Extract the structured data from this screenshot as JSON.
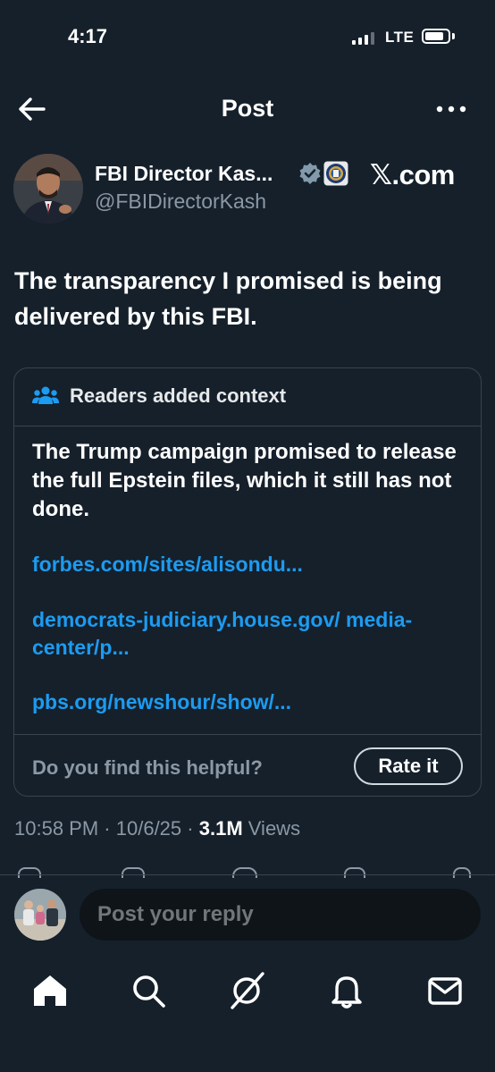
{
  "status_bar": {
    "time": "4:17",
    "network": "LTE"
  },
  "header": {
    "title": "Post",
    "back_icon": "arrow-left-icon",
    "more_icon": "more-horizontal-icon"
  },
  "author": {
    "name": "FBI Director Kas...",
    "handle": "@FBIDirectorKash",
    "verified_icon": "verified-badge-icon",
    "affiliate_icon": "fbi-seal-icon"
  },
  "watermark": "𝕏.com",
  "post": {
    "text": "The transparency I promised is being delivered by this FBI.",
    "meta": {
      "time": "10:58 PM",
      "date": "10/6/25",
      "views_count": "3.1M",
      "views_label": "Views"
    }
  },
  "context": {
    "title": "Readers added context",
    "body": "The Trump campaign promised to release the full Epstein files, which it still has not done.",
    "links": [
      "forbes.com/sites/alisondu...",
      "democrats-judiciary.house.gov/ media-center/p...",
      "pbs.org/newshour/show/..."
    ],
    "helpful_question": "Do you find this helpful?",
    "rate_button": "Rate it"
  },
  "reply": {
    "placeholder": "Post your reply"
  },
  "tab_bar": {
    "items": [
      "home-icon",
      "search-icon",
      "grok-icon",
      "notifications-icon",
      "messages-icon"
    ]
  },
  "colors": {
    "background": "#15202b",
    "link": "#1d9bf0",
    "muted": "#8b98a5",
    "border": "#38444d"
  }
}
